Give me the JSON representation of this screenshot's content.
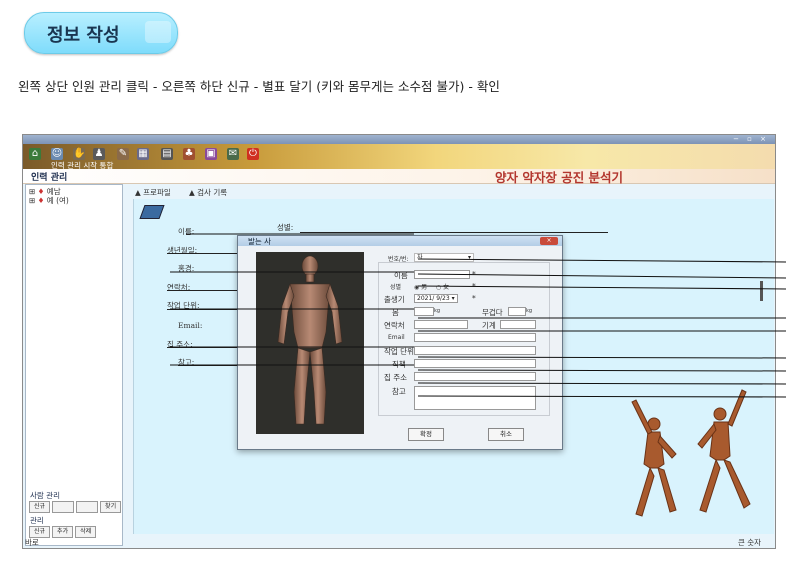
{
  "header": {
    "pill_title": "정보 작성",
    "instruction": "왼쪽 상단 인원 관리 클릭 - 오른쪽 하단 신규 - 별표 달기 (키와 몸무게는 소수점 불가) - 확인"
  },
  "app": {
    "toolbar_label": "인력 관리 시작 통합",
    "section_left": "인력 관리",
    "section_right": "양자 약자장 공진 분석기",
    "tree": [
      "예남",
      "예 (여)"
    ],
    "tabs": [
      "프로파일",
      "검사 기록"
    ],
    "left_panel": {
      "section1": "사람 관리",
      "section1_buttons": [
        "신규",
        "",
        "",
        "찾기"
      ],
      "section2": "관리",
      "section2_buttons": [
        "신규",
        "추가",
        "삭제"
      ]
    },
    "status_left": "바로",
    "status_right": "큰 숫자",
    "main_labels": {
      "name": "이름:",
      "sex": "성별:",
      "birth": "생년월일:",
      "height": "홍경:",
      "contact": "연락처:",
      "job": "작업 단위:",
      "email": "Email:",
      "address": "집 주소:",
      "note": "참고:"
    },
    "dialog": {
      "title": "발는 사",
      "f1_label": "번호/번:",
      "f1_value": "자",
      "name": "이름",
      "sex": "성별",
      "sex_opt1": "男",
      "sex_opt2": "女",
      "birth": "출생기",
      "birth_value": "2021/ 9/23",
      "height": "몸",
      "height_unit": "kg",
      "weight": "무겁다",
      "weight_unit": "kg",
      "contact": "연락처",
      "fixed_phone": "기계",
      "email": "Email",
      "job": "작업 단위",
      "duty": "직책",
      "address": "집 주소",
      "note": "참고",
      "ok": "확정",
      "cancel": "취소"
    }
  }
}
